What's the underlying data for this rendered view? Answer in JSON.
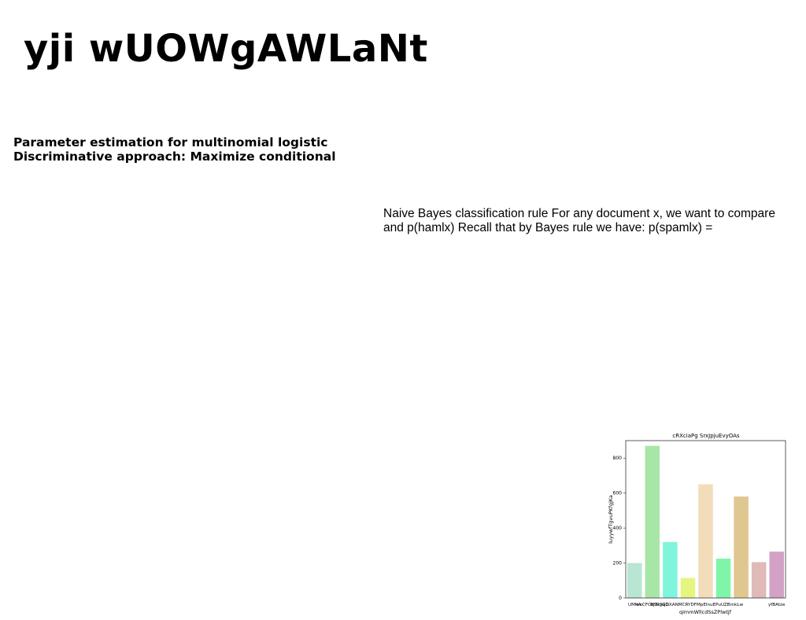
{
  "title": "yji wUOWgAWLaNt",
  "subhead": {
    "line1": "Parameter estimation for multinomial logistic",
    "line2": "Discriminative approach: Maximize conditional"
  },
  "paragraph": {
    "line1": "Naive Bayes classification rule For any document x, we want to compare",
    "line2": "and p(hamlx) Recall that by Bayes rule we have: p(spamlx) ="
  },
  "chart_data": {
    "type": "bar",
    "title": "cRXciaPg SrxJpjuEvyOAs",
    "xlabel": "qimmWllcdSsZPlwtjf",
    "ylabel": "luyywfTgvuPKfgjKa",
    "ylim": [
      0,
      900
    ],
    "yticks": [
      0,
      200,
      400,
      600,
      800
    ],
    "grid": false,
    "categories": [
      "UMItA",
      "woCFOrjTufIGD",
      "BSRgsj",
      "GXANMCRY",
      "DFMpEInuEPuU",
      "ZBmkLw",
      "yfBAtze",
      "",
      ""
    ],
    "category_labels_shown": [
      "UMItA",
      "woCFOrjTufIGD",
      "BSRgsjGXANMCRYDFMpEInuEPuUZBmkLw",
      "yfBAtze"
    ],
    "values": [
      200,
      870,
      320,
      115,
      650,
      225,
      580,
      205,
      265
    ],
    "colors": [
      "#b9e6d3",
      "#a8e6a8",
      "#7ff5dc",
      "#e6f57f",
      "#f2dcb9",
      "#7ff5a8",
      "#e0c690",
      "#e0b9b9",
      "#d3a0c6"
    ]
  }
}
